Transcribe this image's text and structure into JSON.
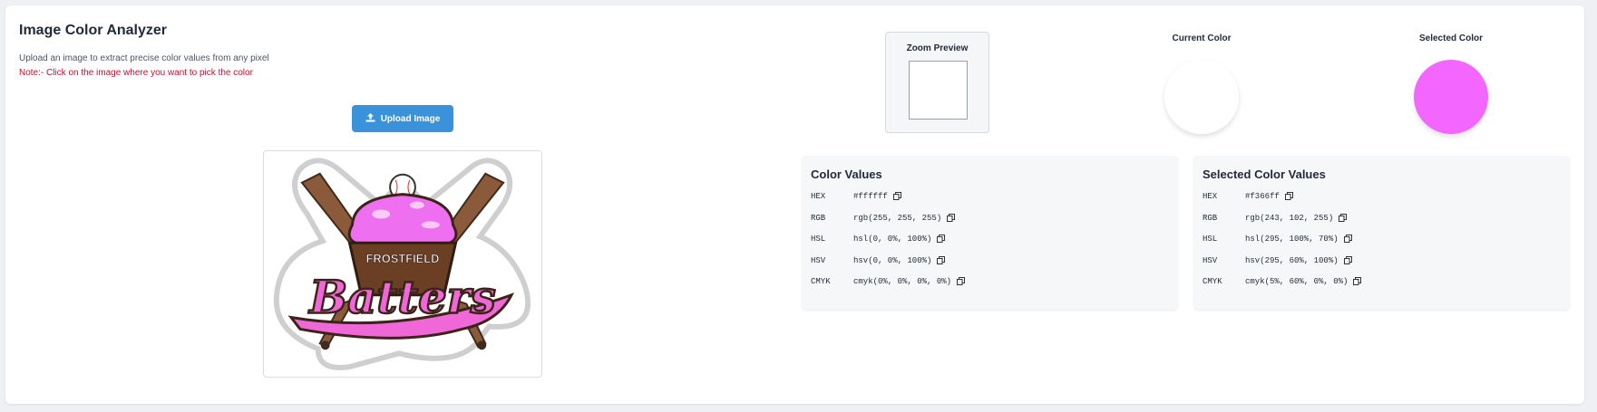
{
  "header": {
    "title": "Image Color Analyzer",
    "subtitle": "Upload an image to extract precise color values from any pixel",
    "note": "Note:- Click on the image where you want to pick the color"
  },
  "upload": {
    "label": "Upload Image",
    "icon": "upload-icon"
  },
  "logo": {
    "line1": "FROSTFIELD",
    "line2": "Batters"
  },
  "zoom": {
    "label": "Zoom Preview"
  },
  "current": {
    "label": "Current Color",
    "color": "#ffffff"
  },
  "selected": {
    "label": "Selected Color",
    "color": "#f366ff"
  },
  "color_values": {
    "title": "Color Values",
    "rows": [
      {
        "key": "HEX",
        "value": "#ffffff"
      },
      {
        "key": "RGB",
        "value": "rgb(255, 255, 255)"
      },
      {
        "key": "HSL",
        "value": "hsl(0, 0%, 100%)"
      },
      {
        "key": "HSV",
        "value": "hsv(0, 0%, 100%)"
      },
      {
        "key": "CMYK",
        "value": "cmyk(0%, 0%, 0%, 0%)"
      }
    ]
  },
  "selected_values": {
    "title": "Selected Color Values",
    "rows": [
      {
        "key": "HEX",
        "value": "#f366ff"
      },
      {
        "key": "RGB",
        "value": "rgb(243, 102, 255)"
      },
      {
        "key": "HSL",
        "value": "hsl(295, 100%, 70%)"
      },
      {
        "key": "HSV",
        "value": "hsv(295, 60%, 100%)"
      },
      {
        "key": "CMYK",
        "value": "cmyk(5%, 60%, 0%, 0%)"
      }
    ]
  },
  "colors": {
    "accent": "#3a92da",
    "note": "#c0122e"
  }
}
